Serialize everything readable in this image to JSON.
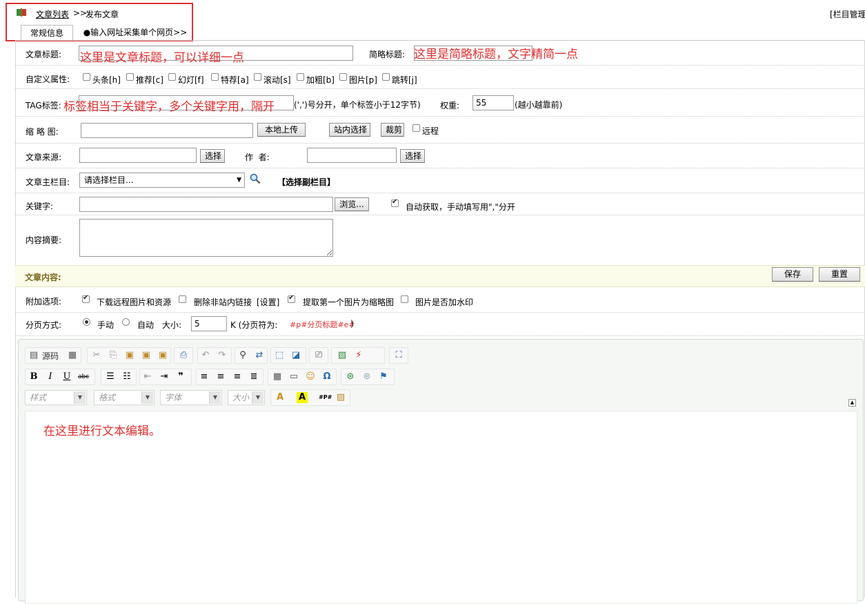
{
  "breadcrumb": {
    "link": "文章列表",
    "sep": ">>",
    "current": "发布文章"
  },
  "top_right": "[栏目管理",
  "tabs": [
    {
      "label": "常规信息"
    },
    {
      "label": "●输入网址采集单个网页>>"
    }
  ],
  "form": {
    "title_label": "文章标题:",
    "short_title_label": "简略标题:",
    "attr_label": "自定义属性:",
    "attrs": [
      "头条[h]",
      "推荐[c]",
      "幻灯[f]",
      "特荐[a]",
      "滚动[s]",
      "加粗[b]",
      "图片[p]",
      "跳转[j]"
    ],
    "tag_label": "TAG标签:",
    "tag_hint": "(',')号分开，单个标签小于12字节)",
    "weight_label": "权重:",
    "weight_value": "55",
    "weight_hint": "(越小越靠前)",
    "thumb_label": "缩 略 图:",
    "btn_upload": "本地上传",
    "btn_site_select": "站内选择",
    "btn_crop": "裁剪",
    "remote_label": "远程",
    "source_label": "文章来源:",
    "btn_select": "选择",
    "author_label": "作  者:",
    "btn_select2": "选择",
    "column_label": "文章主栏目:",
    "column_value": "请选择栏目...",
    "sub_column": "【选择副栏目】",
    "keywords_label": "关键字:",
    "btn_browse": "浏览...",
    "auto_get": "自动获取，手动填写用\",\"分开",
    "summary_label": "内容摘要:"
  },
  "annotations": {
    "title": "这里是文章标题，可以详细一点",
    "short_title": "这里是简略标题，文字精简一点",
    "tag": "标签相当于关键字，多个关键字用，隔开",
    "editor": "在这里进行文本编辑。"
  },
  "content": {
    "header": "文章内容:",
    "btn_save": "保存",
    "btn_reset": "重置",
    "extra_label": "附加选项:",
    "extras": [
      "下载远程图片和资源",
      "删除非站内链接",
      "[设置]",
      "提取第一个图片为缩略图",
      "图片是否加水印"
    ],
    "page_label": "分页方式:",
    "page_manual": "手动",
    "page_auto": "自动",
    "size_label": "大小:",
    "size_value": "5",
    "page_hint_prefix": "K (分页符为:",
    "page_marker": "#p#分页标题#e#",
    "page_hint_suffix": ")"
  },
  "editor": {
    "source_label": "源码",
    "combo_style": "样式",
    "combo_format": "格式",
    "combo_font": "字体",
    "combo_size": "大小"
  }
}
